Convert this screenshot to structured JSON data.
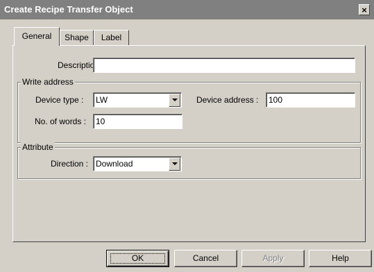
{
  "window": {
    "title": "Create Recipe Transfer Object",
    "close_glyph": "×"
  },
  "tabs": [
    {
      "label": "General",
      "active": true
    },
    {
      "label": "Shape",
      "active": false
    },
    {
      "label": "Label",
      "active": false
    }
  ],
  "general": {
    "description_label": "Description :",
    "description_value": "",
    "write_address": {
      "title": "Write address",
      "device_type_label": "Device type :",
      "device_type_value": "LW",
      "device_address_label": "Device address :",
      "device_address_value": "100",
      "no_of_words_label": "No. of words :",
      "no_of_words_value": "10"
    },
    "attribute": {
      "title": "Attribute",
      "direction_label": "Direction :",
      "direction_value": "Download"
    }
  },
  "buttons": {
    "ok": "OK",
    "cancel": "Cancel",
    "apply": "Apply",
    "help": "Help"
  }
}
